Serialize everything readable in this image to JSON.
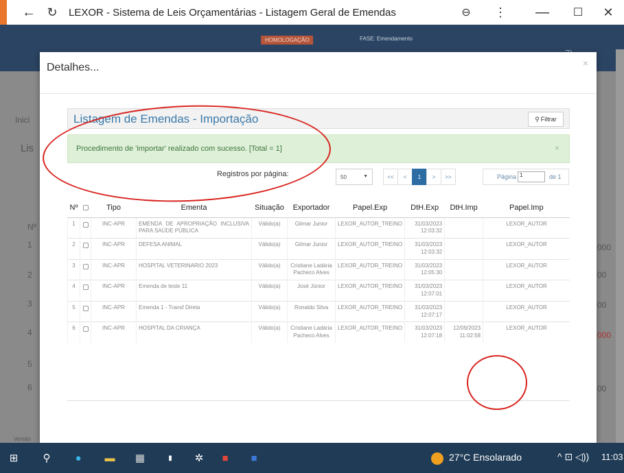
{
  "browser": {
    "title": "LEXOR - Sistema de Leis Orçamentárias - Listagem Geral de Emendas",
    "back_icon": "back-arrow-icon",
    "reload_icon": "reload-icon",
    "zoom_icon": "zoom-icon",
    "menu_icon": "menu-icon",
    "minimize": "—",
    "maximize": "☐",
    "close": "✕"
  },
  "background": {
    "env_badge": "HOMOLOGAÇÃO",
    "phase": "FASE: Emendamento",
    "user": "...7)",
    "breadcrumb": "Inici",
    "list_prefix": "Lis",
    "col_n": "Nº",
    "rows": [
      "1",
      "2",
      "3",
      "4",
      "5",
      "6"
    ],
    "right_values": [
      "000",
      "00",
      "00",
      "000",
      "00"
    ],
    "version": "Versão"
  },
  "modal": {
    "title": "Detalhes...",
    "close": "×",
    "panel_title": "Listagem de Emendas - Importação",
    "filter_label": "Filtrar",
    "alert": "Procedimento de 'importar' realizado com sucesso. [Total = 1]",
    "alert_close": "×",
    "pager": {
      "per_page_label": "Registros por página:",
      "per_page_value": "50",
      "first": "<<",
      "prev": "<",
      "current": "1",
      "next": ">",
      "last": ">>",
      "page_label": "Página",
      "page_value": "1",
      "page_of": "de 1"
    },
    "table": {
      "headers": [
        "Nº",
        "",
        "Tipo",
        "Ementa",
        "Situação",
        "Exportador",
        "Papel.Exp",
        "DtH.Exp",
        "DtH.Imp",
        "Papel.Imp"
      ],
      "rows": [
        {
          "n": "1",
          "tipo": "INC-APR",
          "ementa": "EMENDA DE APROPRIAÇÃO INCLUSIVA PARA SAÚDE PÚBLICA",
          "situacao": "Válido(a)",
          "exportador": "Gilmar Junior",
          "papel_exp": "LEXOR_AUTOR_TREINO",
          "dth_exp": "31/03/2023 12:03:32",
          "dth_imp": "",
          "papel_imp": "LEXOR_AUTOR"
        },
        {
          "n": "2",
          "tipo": "INC-APR",
          "ementa": "DEFESA ANIMAL",
          "situacao": "Válido(a)",
          "exportador": "Gilmar Junior",
          "papel_exp": "LEXOR_AUTOR_TREINO",
          "dth_exp": "31/03/2023 12:03:32",
          "dth_imp": "",
          "papel_imp": "LEXOR_AUTOR"
        },
        {
          "n": "3",
          "tipo": "INC-APR",
          "ementa": "HOSPITAL VETERINARIO 2023",
          "situacao": "Válido(a)",
          "exportador": "Cristiane Ladária Pacheco Alves",
          "papel_exp": "LEXOR_AUTOR_TREINO",
          "dth_exp": "31/03/2023 12:05:30",
          "dth_imp": "",
          "papel_imp": "LEXOR_AUTOR"
        },
        {
          "n": "4",
          "tipo": "INC-APR",
          "ementa": "Emenda de teste 11",
          "situacao": "Válido(a)",
          "exportador": "José Júnior",
          "papel_exp": "LEXOR_AUTOR_TREINO",
          "dth_exp": "31/03/2023 12:07:01",
          "dth_imp": "",
          "papel_imp": "LEXOR_AUTOR"
        },
        {
          "n": "5",
          "tipo": "INC-APR",
          "ementa": "Emenda 1 - Transf Direta",
          "situacao": "Válido(a)",
          "exportador": "Ronaldo Silva",
          "papel_exp": "LEXOR_AUTOR_TREINO",
          "dth_exp": "31/03/2023 12:07:17",
          "dth_imp": "",
          "papel_imp": "LEXOR_AUTOR"
        },
        {
          "n": "6",
          "tipo": "INC-APR",
          "ementa": "HOSPITAL DA CRIANÇA",
          "situacao": "Válido(a)",
          "exportador": "Cristiane Ladária Pacheco Alves",
          "papel_exp": "LEXOR_AUTOR_TREINO",
          "dth_exp": "31/03/2023 12:07:18",
          "dth_imp": "12/09/2023 11:02:58",
          "papel_imp": "LEXOR_AUTOR"
        }
      ]
    }
  },
  "taskbar": {
    "weather": "27°C  Ensolarado",
    "tray": "^  ⊡  ◁))",
    "time": "11:03"
  },
  "colors": {
    "accent": "#2e6da4",
    "annotation": "#d8231e",
    "success_bg": "#dff0d8"
  }
}
